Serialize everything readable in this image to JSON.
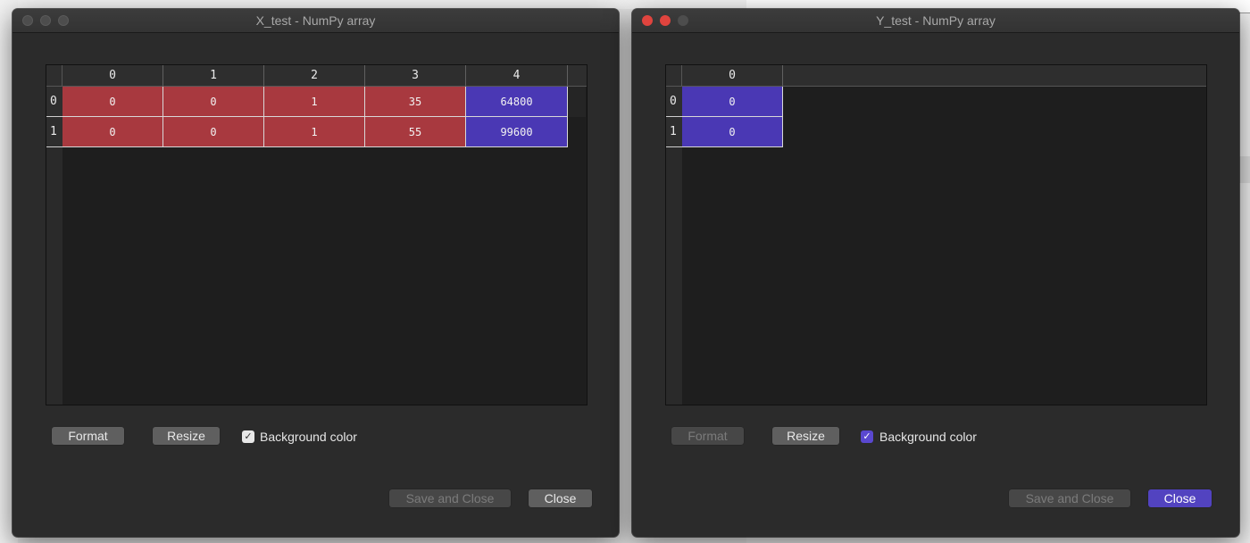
{
  "x_window": {
    "title": "X_test - NumPy array",
    "columns": [
      "0",
      "1",
      "2",
      "3",
      "4"
    ],
    "row_labels": [
      "0",
      "1"
    ],
    "rows": [
      [
        "0",
        "0",
        "1",
        "35",
        "64800"
      ],
      [
        "0",
        "0",
        "1",
        "55",
        "99600"
      ]
    ],
    "buttons": {
      "format": "Format",
      "resize": "Resize",
      "save_close": "Save and Close",
      "close": "Close"
    },
    "background_color_label": "Background color",
    "background_color_checked": true
  },
  "y_window": {
    "title": "Y_test - NumPy array",
    "columns": [
      "0"
    ],
    "row_labels": [
      "0",
      "1"
    ],
    "rows": [
      [
        "0"
      ],
      [
        "0"
      ]
    ],
    "buttons": {
      "format": "Format",
      "resize": "Resize",
      "save_close": "Save and Close",
      "close": "Close"
    },
    "background_color_label": "Background color",
    "background_color_checked": true
  },
  "colors": {
    "cell_low": "#a8393f",
    "cell_high": "#4a38b4",
    "default_button": "#5243c0",
    "window_bg": "#2b2b2b"
  }
}
